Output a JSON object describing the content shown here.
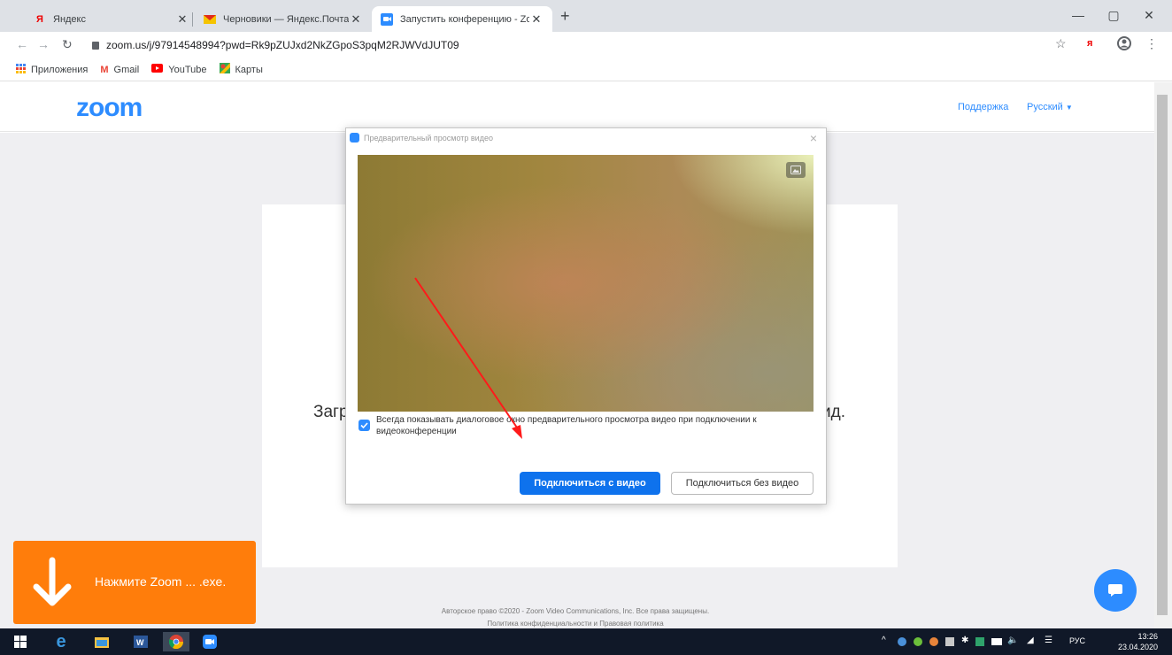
{
  "browser": {
    "tabs": [
      {
        "title": "Яндекс",
        "favicon": "yandex-icon",
        "active": false
      },
      {
        "title": "Черновики — Яндекс.Почта",
        "favicon": "yandex-mail-icon",
        "active": false
      },
      {
        "title": "Запустить конференцию - Zoom",
        "favicon": "zoom-icon",
        "active": true
      }
    ],
    "url": "zoom.us/j/97914548994?pwd=Rk9pZUJxd2NkZGpoS3pqM2RJWVdJUT09",
    "bookmarks": [
      {
        "label": "Приложения",
        "icon": "apps-grid-icon"
      },
      {
        "label": "Gmail",
        "icon": "gmail-icon"
      },
      {
        "label": "YouTube",
        "icon": "youtube-icon"
      },
      {
        "label": "Карты",
        "icon": "maps-icon"
      }
    ]
  },
  "zoom": {
    "logo": "zoom",
    "support_link": "Поддержка",
    "language": "Русский",
    "launch_text_left": "Загр",
    "launch_text_right": "ид.",
    "footer_line1": "Авторское право ©2020 - Zoom Video Communications, Inc. Все права защищены.",
    "footer_line2": "Политика конфиденциальности и Правовая политика",
    "download_banner": "Нажмите Zoom ... .exe."
  },
  "dialog": {
    "title": "Предварительный просмотр видео",
    "checkbox_label": "Всегда показывать диалоговое окно предварительного просмотра видео при подключении к видеоконференции",
    "checkbox_checked": true,
    "join_with_video": "Подключиться с видео",
    "join_without_video": "Подключиться без видео"
  },
  "taskbar": {
    "lang": "РУС",
    "time": "13:26",
    "date": "23.04.2020"
  },
  "colors": {
    "zoom_blue": "#2d8cff",
    "button_blue": "#0e72ed",
    "banner_orange": "#ff7d0b",
    "arrow_red": "#ff1a1a"
  }
}
